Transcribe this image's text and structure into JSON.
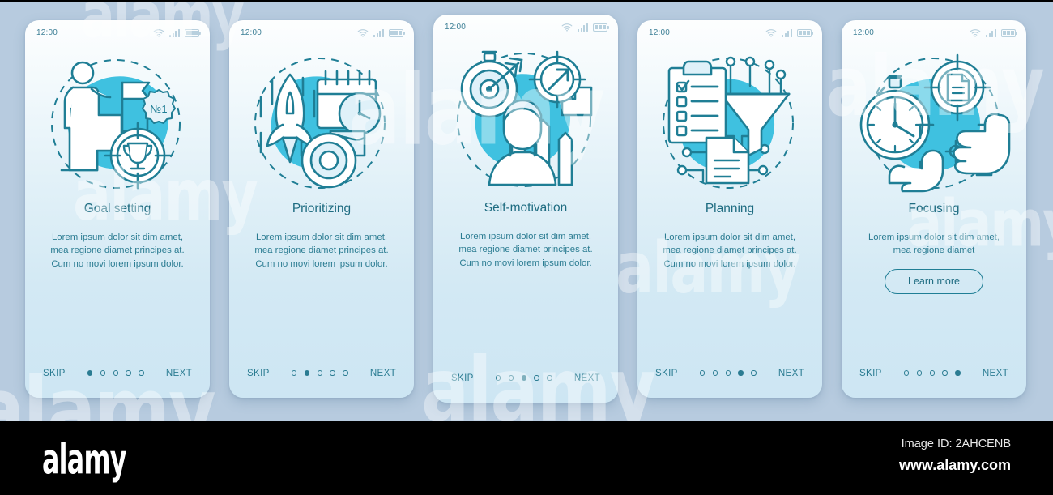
{
  "meta": {
    "background_color": "#b7cbdf",
    "accent_color": "#2b7c92",
    "illustration_fill": "#3fc1e0",
    "card_gradient_top": "#fdfefe",
    "card_gradient_bottom": "#cde6f3"
  },
  "watermark": {
    "text": "alamy"
  },
  "statusbar": {
    "time": "12:00",
    "icons": [
      "wifi-icon",
      "signal-icon",
      "battery-icon"
    ]
  },
  "nav_labels": {
    "skip": "SKIP",
    "next": "NEXT"
  },
  "screens": [
    {
      "id": "goal-setting",
      "title": "Goal setting",
      "description": "Lorem ipsum dolor sit dim amet, mea regione diamet principes at. Cum no movi lorem ipsum dolor.",
      "illustration": "man-climbing-stairs-flag-trophy-target",
      "badge_text": "№1",
      "skip": "SKIP",
      "next": "NEXT",
      "active_dot": 0,
      "dot_count": 5,
      "has_button": false,
      "button_label": ""
    },
    {
      "id": "prioritizing",
      "title": "Prioritizing",
      "description": "Lorem ipsum dolor sit dim amet, mea regione diamet principes at. Cum no movi lorem ipsum dolor.",
      "illustration": "rocket-calendar-clock-flag-target",
      "badge_text": "",
      "skip": "SKIP",
      "next": "NEXT",
      "active_dot": 1,
      "dot_count": 5,
      "has_button": false,
      "button_label": ""
    },
    {
      "id": "self-motivation",
      "title": "Self-motivation",
      "description": "Lorem ipsum dolor sit dim amet, mea regione diamet principes at. Cum no movi lorem ipsum dolor.",
      "illustration": "person-arrows-target-stopwatch-stairs",
      "badge_text": "",
      "skip": "SKIP",
      "next": "NEXT",
      "active_dot": 2,
      "dot_count": 5,
      "has_button": false,
      "button_label": ""
    },
    {
      "id": "planning",
      "title": "Planning",
      "description": "Lorem ipsum dolor sit dim amet, mea regione diamet principes at. Cum no movi lorem ipsum dolor.",
      "illustration": "clipboard-checklist-funnel-document-network",
      "badge_text": "",
      "skip": "SKIP",
      "next": "NEXT",
      "active_dot": 3,
      "dot_count": 5,
      "has_button": false,
      "button_label": ""
    },
    {
      "id": "focusing",
      "title": "Focusing",
      "description": "Lorem ipsum dolor sit dim amet, mea regione diamet",
      "illustration": "stopwatch-document-target-pointing-hands",
      "badge_text": "",
      "skip": "SKIP",
      "next": "NEXT",
      "active_dot": 4,
      "dot_count": 5,
      "has_button": true,
      "button_label": "Learn more"
    }
  ],
  "footer": {
    "logo": "alamy",
    "image_id": "Image ID: 2AHCENB",
    "website": "www.alamy.com"
  }
}
